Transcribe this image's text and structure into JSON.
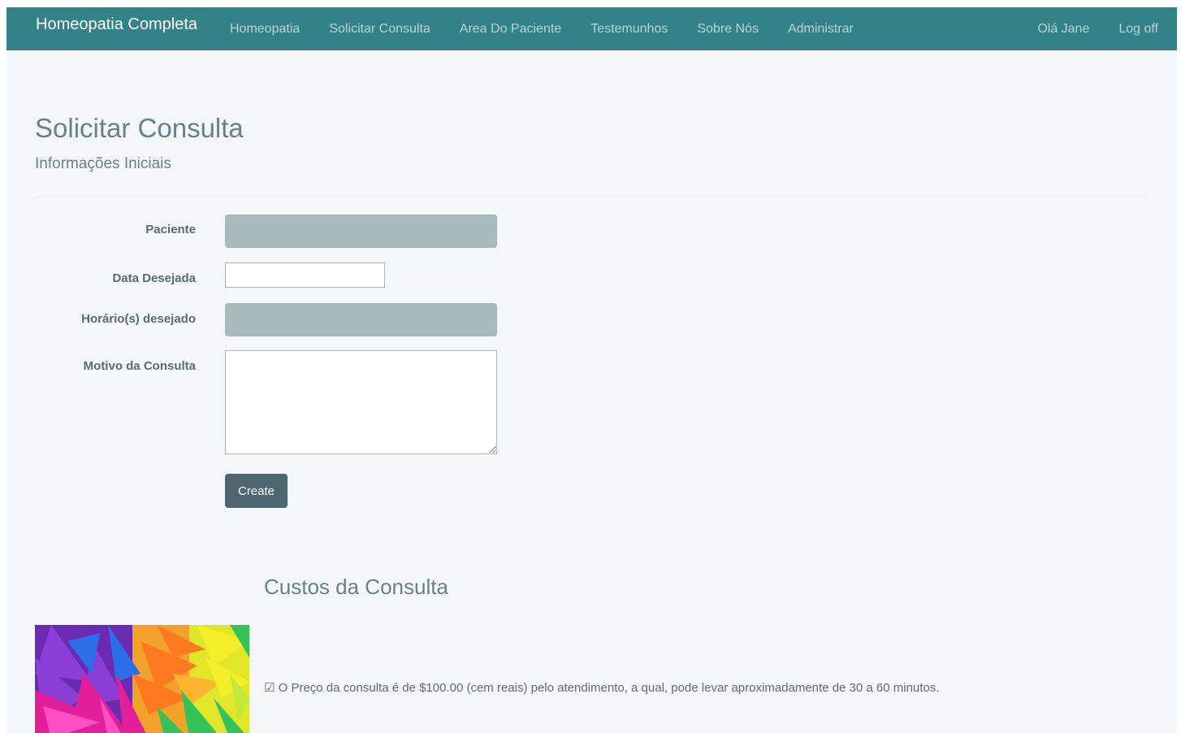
{
  "navbar": {
    "brand": "Homeopatia Completa",
    "links": [
      {
        "label": "Homeopatia"
      },
      {
        "label": "Solicitar Consulta"
      },
      {
        "label": "Area Do Paciente"
      },
      {
        "label": "Testemunhos"
      },
      {
        "label": "Sobre Nós"
      },
      {
        "label": "Administrar"
      }
    ],
    "greeting": "Olá Jane",
    "logoff": "Log off",
    "colors": {
      "background": "#338288",
      "link": "#b9d3d5",
      "brand": "#ffffff"
    }
  },
  "page": {
    "title": "Solicitar Consulta",
    "subtitle": "Informações Iniciais"
  },
  "form": {
    "paciente_label": "Paciente",
    "paciente_value": "",
    "data_label": "Data Desejada",
    "data_value": "",
    "horario_label": "Horário(s) desejado",
    "horario_value": "",
    "motivo_label": "Motivo da Consulta",
    "motivo_value": "",
    "create_label": "Create",
    "colors": {
      "disabled_field": "#a7bbbc",
      "button": "#4f6570"
    }
  },
  "costs": {
    "title": "Custos da Consulta",
    "check_icon": "☑",
    "price_text": "O Preço da consulta é de $100.00 (cem reais) pelo atendimento, a qual, pode levar aproximadamente de 30 a 60 minutos.",
    "image": "colorful-flowers-photo"
  }
}
